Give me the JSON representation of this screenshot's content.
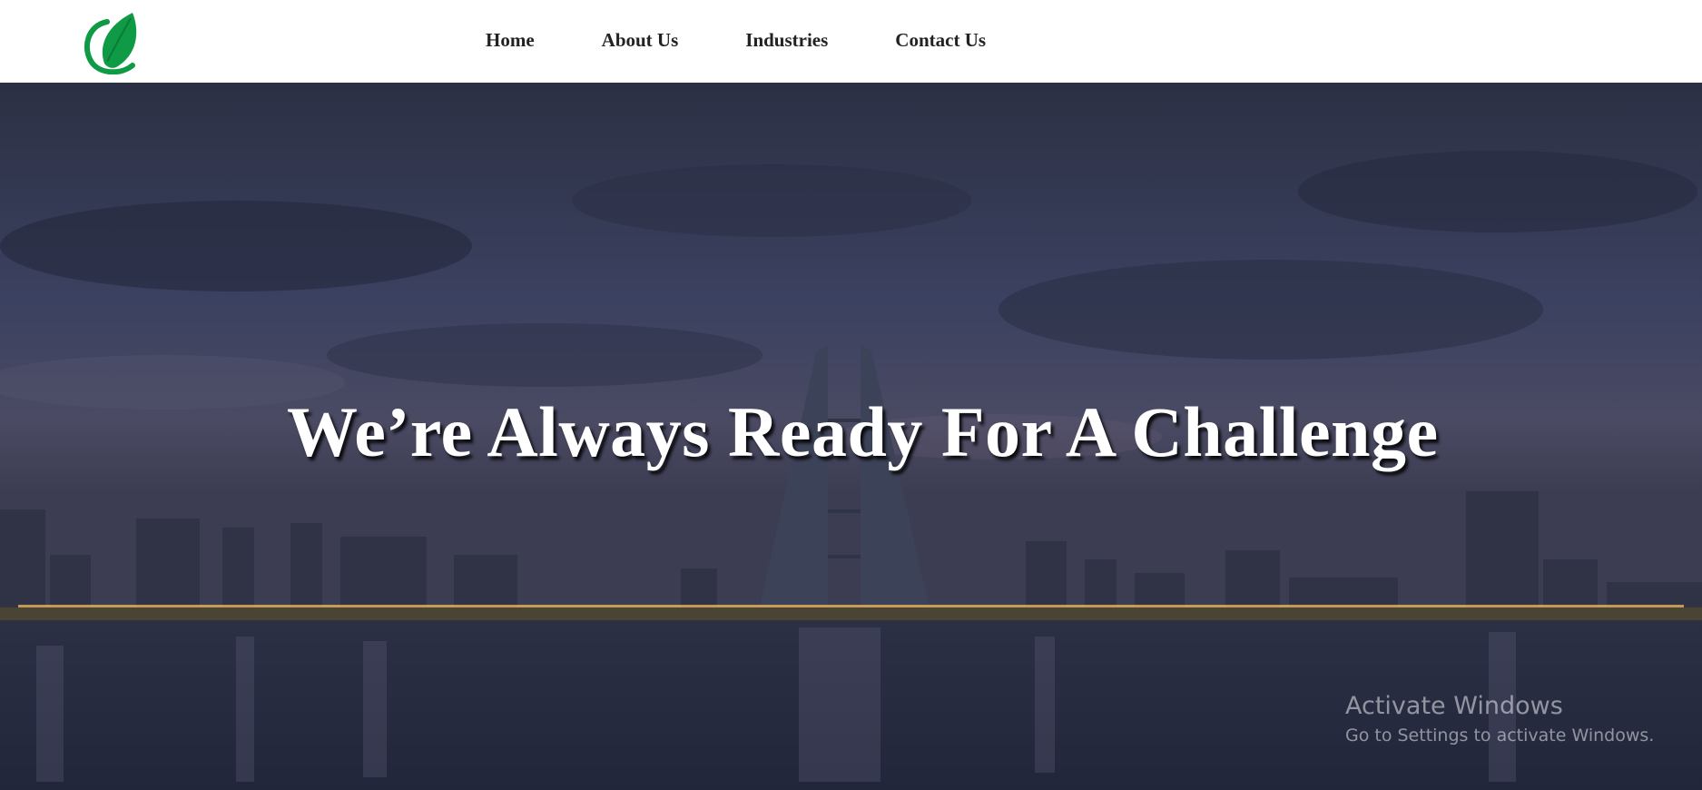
{
  "header": {
    "logo_icon": "leaf-logo-icon",
    "brand_color": "#0f9a46",
    "nav": [
      {
        "label": "Home"
      },
      {
        "label": "About Us"
      },
      {
        "label": "Industries"
      },
      {
        "label": "Contact Us"
      }
    ]
  },
  "hero": {
    "title": "We’re Always Ready For A Challenge",
    "background": "city-skyline-at-dusk-image"
  },
  "watermark": {
    "title": "Activate Windows",
    "subtitle": "Go to Settings to activate Windows."
  }
}
